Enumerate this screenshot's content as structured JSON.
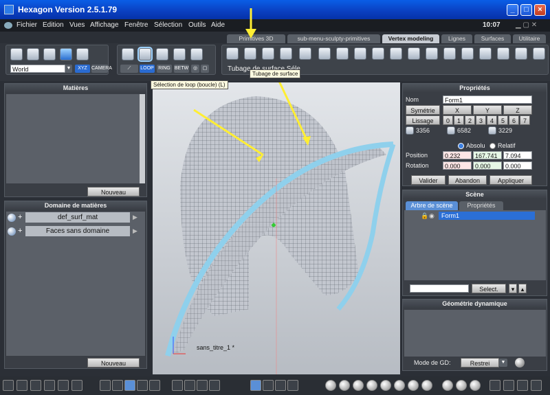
{
  "window": {
    "title": "Hexagon Version 2.5.1.79",
    "time": "10:07",
    "min_label": "_",
    "max_label": "□",
    "close_label": "×"
  },
  "menu": [
    "Fichier",
    "Edition",
    "Vues",
    "Affichage",
    "Fenêtre",
    "Sélection",
    "Outils",
    "Aide"
  ],
  "tabs": [
    "Primitives 3D",
    "sub-menu-sculpty-primitives",
    "Vertex modeling",
    "Lignes",
    "Surfaces",
    "Utilitaire"
  ],
  "active_tab": "Vertex modeling",
  "toolbar": {
    "coord_system": "World",
    "coord_buttons": [
      "XYZ",
      "CAMERA"
    ],
    "selection_buttons": [
      "LOOP",
      "RING",
      "BETW"
    ],
    "status_text": "Tubage de surface Séle",
    "tooltip_loop": "Sélection de loop (boucle) (L)",
    "tooltip_tube": "Tubage de surface"
  },
  "left_panels": {
    "materials": {
      "title": "Matières",
      "button": "Nouveau"
    },
    "domains": {
      "title": "Domaine de matières",
      "rows": [
        {
          "label": "def_surf_mat"
        },
        {
          "label": "Faces sans domaine"
        }
      ],
      "button": "Nouveau"
    }
  },
  "properties": {
    "title": "Propriétés",
    "name_label": "Nom",
    "name_value": "Form1",
    "sym_label": "Symétrie",
    "axes": [
      "X",
      "Y",
      "Z"
    ],
    "smooth_label": "Lissage",
    "smooth_levels": [
      "0",
      "1",
      "2",
      "3",
      "4",
      "5",
      "6",
      "7"
    ],
    "counts": [
      "3356",
      "6582",
      "3229"
    ],
    "absolute_label": "Absolu",
    "relative_label": "Relatif",
    "position_label": "Position",
    "position": [
      "0.232",
      "167.741",
      "7.094"
    ],
    "rotation_label": "Rotation",
    "rotation": [
      "0.000",
      "0.000",
      "0.000"
    ],
    "buttons": [
      "Valider",
      "Abandon",
      "Appliquer"
    ]
  },
  "scene": {
    "title": "Scène",
    "tabs": [
      "Arbre de scène",
      "Propriétés"
    ],
    "object": "Form1",
    "select_button": "Select."
  },
  "dyn_geometry": {
    "title": "Géométrie dynamique",
    "mode_label": "Mode de GD:",
    "mode_value": "Restrei"
  },
  "viewport": {
    "object_label": "sans_titre_1 *"
  }
}
